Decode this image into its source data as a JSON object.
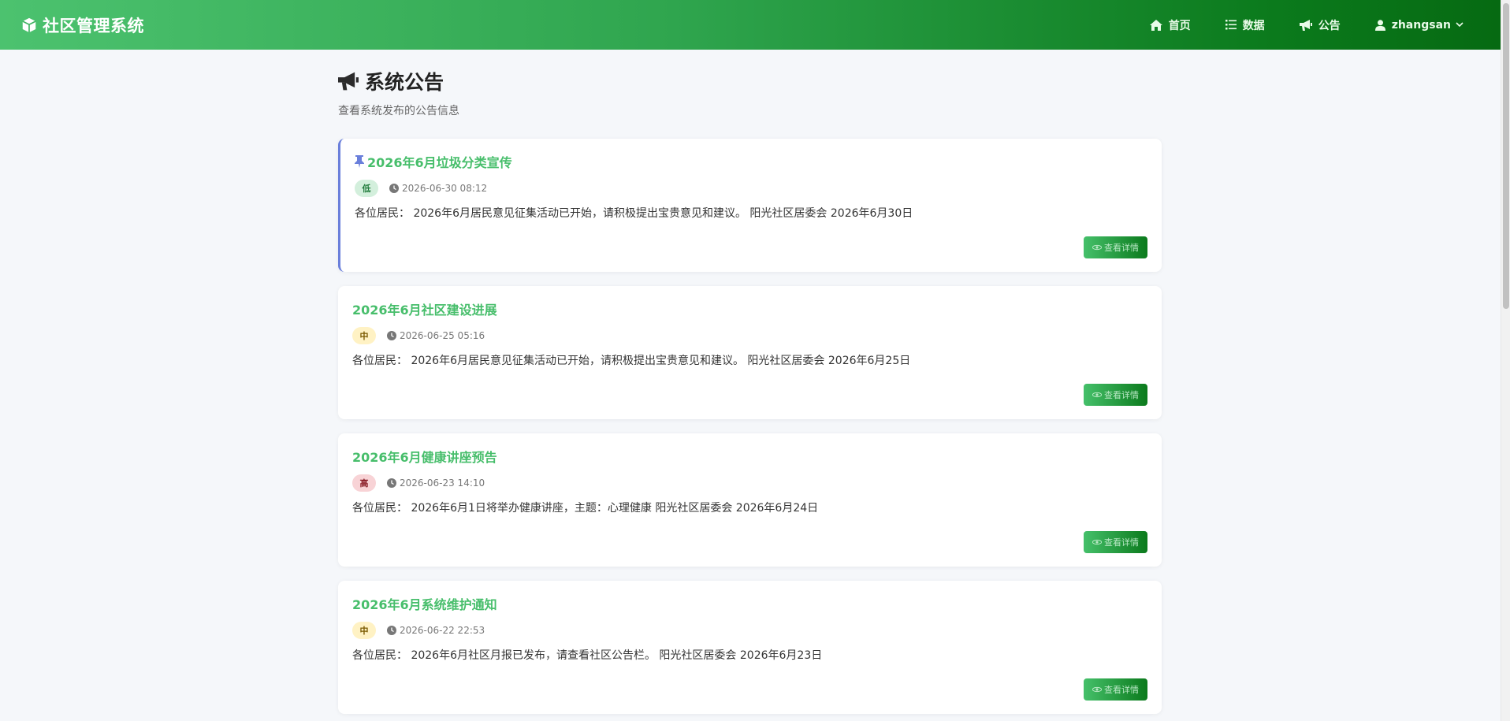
{
  "navbar": {
    "brand": "社区管理系统",
    "items": [
      {
        "label": "首页",
        "icon": "home-icon"
      },
      {
        "label": "数据",
        "icon": "list-icon"
      },
      {
        "label": "公告",
        "icon": "bullhorn-icon"
      }
    ],
    "user": {
      "label": "zhangsan",
      "icon": "user-icon"
    }
  },
  "page": {
    "title": "系统公告",
    "subtitle": "查看系统发布的公告信息"
  },
  "announcements": [
    {
      "title": "2026年6月垃圾分类宣传",
      "pinned": true,
      "priority": "低",
      "time": "2026-06-30 08:12",
      "content": "各位居民： 2026年6月居民意见征集活动已开始，请积极提出宝贵意见和建议。 阳光社区居委会 2026年6月30日",
      "button": "查看详情"
    },
    {
      "title": "2026年6月社区建设进展",
      "pinned": false,
      "priority": "中",
      "time": "2026-06-25 05:16",
      "content": "各位居民： 2026年6月居民意见征集活动已开始，请积极提出宝贵意见和建议。 阳光社区居委会 2026年6月25日",
      "button": "查看详情"
    },
    {
      "title": "2026年6月健康讲座预告",
      "pinned": false,
      "priority": "高",
      "time": "2026-06-23 14:10",
      "content": "各位居民： 2026年6月1日将举办健康讲座，主题：心理健康 阳光社区居委会 2026年6月24日",
      "button": "查看详情"
    },
    {
      "title": "2026年6月系统维护通知",
      "pinned": false,
      "priority": "中",
      "time": "2026-06-22 22:53",
      "content": "各位居民： 2026年6月社区月报已发布，请查看社区公告栏。 阳光社区居委会 2026年6月23日",
      "button": "查看详情"
    }
  ],
  "colors": {
    "accent": "#47be6b",
    "nav_dark": "#066a12",
    "pin": "#6a7fdb"
  }
}
